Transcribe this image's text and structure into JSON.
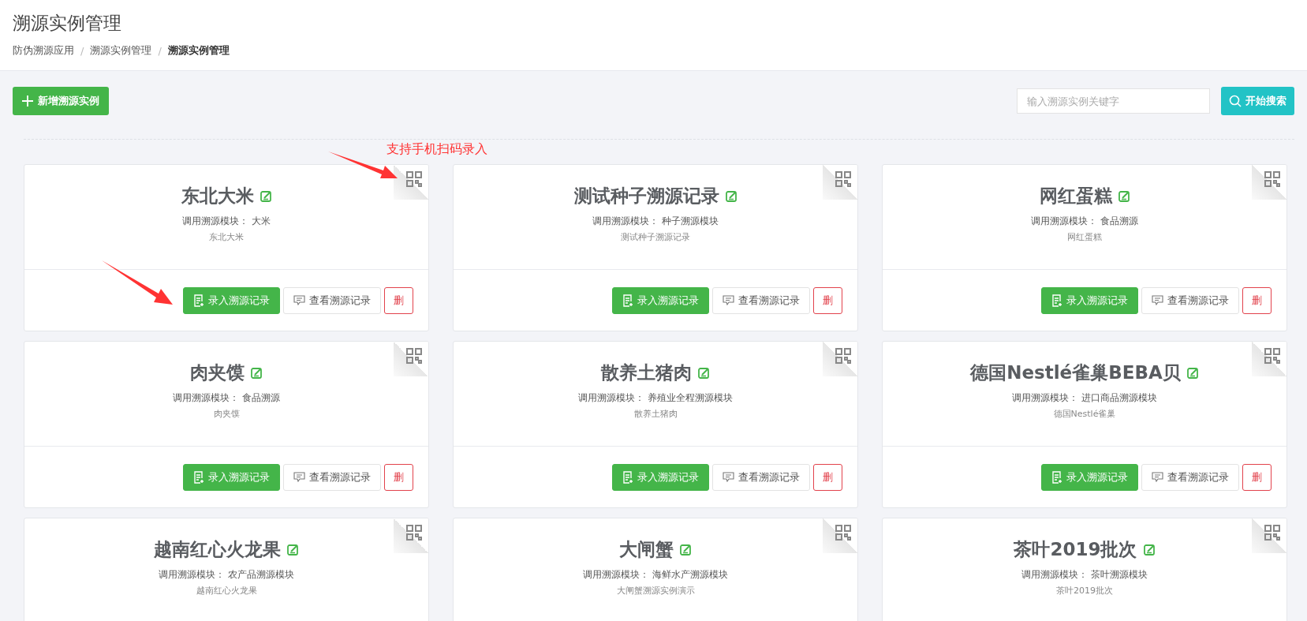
{
  "page_title": "溯源实例管理",
  "breadcrumb_separator": "/",
  "breadcrumb": [
    {
      "label": "防伪溯源应用",
      "current": false
    },
    {
      "label": "溯源实例管理",
      "current": false
    },
    {
      "label": "溯源实例管理",
      "current": true
    }
  ],
  "add_button": "新增溯源实例",
  "search": {
    "placeholder": "输入溯源实例关键字",
    "button": "开始搜索"
  },
  "annotation": "支持手机扫码录入",
  "cards": [
    {
      "title": "东北大米",
      "module": "调用溯源模块： 大米",
      "description": "东北大米",
      "actions": [
        {
          "kind": "primary",
          "label": "录入溯源记录"
        },
        {
          "kind": "default",
          "label": "查看溯源记录"
        },
        {
          "kind": "danger",
          "label": "删"
        }
      ]
    },
    {
      "title": "测试种子溯源记录",
      "module": "调用溯源模块： 种子溯源模块",
      "description": "测试种子溯源记录",
      "actions": [
        {
          "kind": "primary",
          "label": "录入溯源记录"
        },
        {
          "kind": "default",
          "label": "查看溯源记录"
        },
        {
          "kind": "danger",
          "label": "删"
        }
      ]
    },
    {
      "title": "网红蛋糕",
      "module": "调用溯源模块： 食品溯源",
      "description": "网红蛋糕",
      "actions": [
        {
          "kind": "primary",
          "label": "录入溯源记录"
        },
        {
          "kind": "default",
          "label": "查看溯源记录"
        },
        {
          "kind": "danger",
          "label": "删"
        }
      ]
    },
    {
      "title": "肉夹馍",
      "module": "调用溯源模块： 食品溯源",
      "description": "肉夹馍",
      "actions": [
        {
          "kind": "primary",
          "label": "录入溯源记录"
        },
        {
          "kind": "default",
          "label": "查看溯源记录"
        },
        {
          "kind": "danger",
          "label": "删"
        }
      ]
    },
    {
      "title": "散养土猪肉",
      "module": "调用溯源模块： 养殖业全程溯源模块",
      "description": "散养土猪肉",
      "actions": [
        {
          "kind": "primary",
          "label": "录入溯源记录"
        },
        {
          "kind": "default",
          "label": "查看溯源记录"
        },
        {
          "kind": "danger",
          "label": "删"
        }
      ]
    },
    {
      "title": "德国Nestlé雀巢BEBA贝",
      "module": "调用溯源模块： 进口商品溯源模块",
      "description": "德国Nestlé雀巢",
      "actions": [
        {
          "kind": "primary",
          "label": "录入溯源记录"
        },
        {
          "kind": "default",
          "label": "查看溯源记录"
        },
        {
          "kind": "danger",
          "label": "删"
        }
      ]
    },
    {
      "title": "越南红心火龙果",
      "module": "调用溯源模块： 农产品溯源模块",
      "description": "越南红心火龙果"
    },
    {
      "title": "大闸蟹",
      "module": "调用溯源模块： 海鲜水产溯源模块",
      "description": "大闸蟹溯源实例演示"
    },
    {
      "title": "茶叶2019批次",
      "module": "调用溯源模块： 茶叶溯源模块",
      "description": "茶叶2019批次"
    }
  ]
}
